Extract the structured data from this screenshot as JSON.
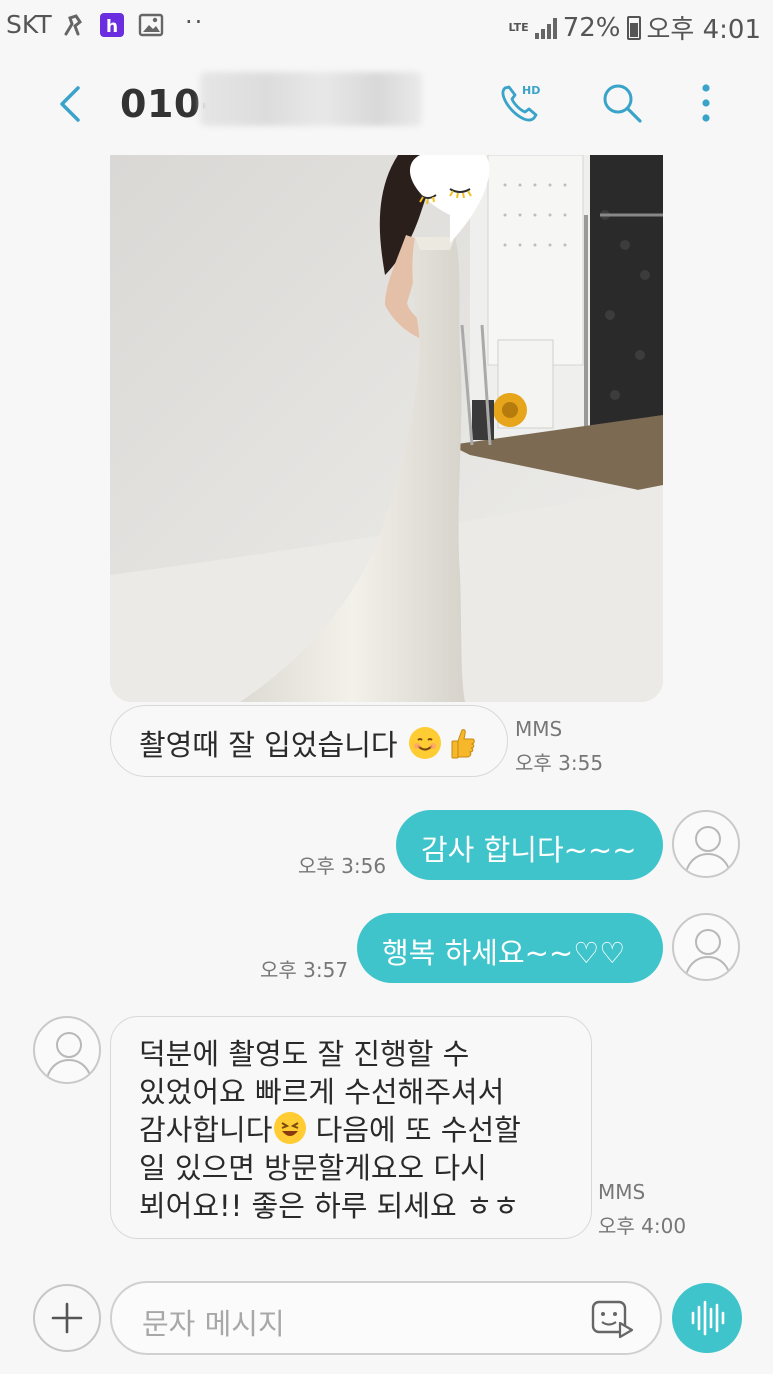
{
  "status_bar": {
    "carrier": "SKT",
    "network": "LTE",
    "battery": "72%",
    "time": "오후 4:01",
    "dots": "··"
  },
  "header": {
    "contact": "010-",
    "icons": [
      "back-icon",
      "hd-call-icon",
      "search-icon",
      "more-icon"
    ]
  },
  "messages": [
    {
      "direction": "incoming",
      "text": "촬영때 잘 입었습니다",
      "emoji": [
        "smile-emoji",
        "thumbs-up-emoji"
      ],
      "type_label": "MMS",
      "time": "오후 3:55"
    },
    {
      "direction": "outgoing",
      "text": "감사 합니다~~~",
      "time": "오후 3:56"
    },
    {
      "direction": "outgoing",
      "text": "행복 하세요~~♡♡",
      "time": "오후 3:57"
    },
    {
      "direction": "incoming",
      "lines": [
        "덕분에 촬영도 잘 진행할 수",
        "있었어요 빠르게 수선해주셔서",
        "감사합니다",
        "일 있으면 방문할게요오 다시",
        "뵈어요!! 좋은 하루 되세요 ㅎㅎ"
      ],
      "line3_tail": " 다음에 또 수선할",
      "emoji": [
        "laughing-emoji"
      ],
      "type_label": "MMS",
      "time": "오후 4:00"
    }
  ],
  "input": {
    "placeholder": "문자 메시지"
  },
  "colors": {
    "accent": "#40c4cc",
    "background": "#f7f7f7",
    "incoming_bubble": "#f8f8f8"
  }
}
